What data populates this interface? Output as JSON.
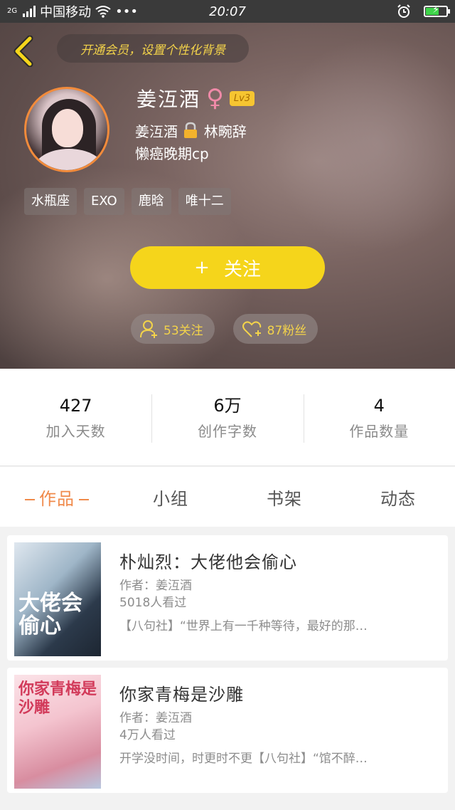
{
  "status_bar": {
    "network_type": "2G",
    "carrier": "中国移动",
    "more": "•••",
    "time": "20:07",
    "battery_color": "#3fd44a"
  },
  "header": {
    "back_icon": "chevron-left-icon",
    "vip_banner": "开通会员，设置个性化背景",
    "name": "姜沍酒",
    "gender_symbol": "♀",
    "level": "Lv3",
    "bio_line1_a": "姜沍酒",
    "bio_line1_b": "林畹辞",
    "bio_line2": "懒癌晚期cp",
    "tags": [
      "水瓶座",
      "EXO",
      "鹿晗",
      "唯十二"
    ],
    "follow_plus": "+",
    "follow_label": "关注",
    "following_count": "53关注",
    "fans_count": "87粉丝",
    "accent": "#f5d51b"
  },
  "stats": [
    {
      "value": "427",
      "label": "加入天数"
    },
    {
      "value": "6万",
      "label": "创作字数"
    },
    {
      "value": "4",
      "label": "作品数量"
    }
  ],
  "tabs": [
    {
      "label": "作品",
      "active": true
    },
    {
      "label": "小组",
      "active": false
    },
    {
      "label": "书架",
      "active": false
    },
    {
      "label": "动态",
      "active": false
    }
  ],
  "works": [
    {
      "cover_text": "大佬会偷心",
      "title": "朴灿烈：大佬他会偷心",
      "author": "作者：姜沍酒",
      "views": "5018人看过",
      "desc": "【八句社】“世界上有一千种等待，最好的那…"
    },
    {
      "cover_text": "你家青梅是沙雕",
      "title": "你家青梅是沙雕",
      "author": "作者：姜沍酒",
      "views": "4万人看过",
      "desc": "开学没时间，时更时不更【八句社】“馆不醉…"
    }
  ]
}
